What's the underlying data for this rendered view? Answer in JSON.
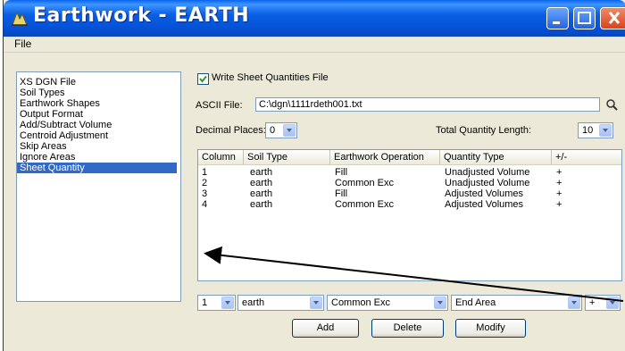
{
  "window": {
    "title": "Earthwork - EARTH"
  },
  "menu": {
    "file_label": "File"
  },
  "nav": {
    "items": [
      {
        "label": "XS DGN File"
      },
      {
        "label": "Soil Types"
      },
      {
        "label": "Earthwork Shapes"
      },
      {
        "label": "Output Format"
      },
      {
        "label": "Add/Subtract Volume"
      },
      {
        "label": "Centroid Adjustment"
      },
      {
        "label": "Skip Areas"
      },
      {
        "label": "Ignore Areas"
      },
      {
        "label": "Sheet Quantity",
        "selected": true
      }
    ]
  },
  "sheet": {
    "write_label": "Write Sheet Quantities File",
    "write_checked": true,
    "ascii_label": "ASCII File:",
    "ascii_value": "C:\\dgn\\1111rdeth001.txt",
    "decimal_label": "Decimal Places:",
    "decimal_value": "0",
    "total_label": "Total Quantity Length:",
    "total_value": "10"
  },
  "table": {
    "columns": [
      "Column",
      "Soil Type",
      "Earthwork Operation",
      "Quantity Type",
      "+/-"
    ],
    "rows": [
      [
        "1",
        "earth",
        "Fill",
        "Unadjusted Volume",
        "+"
      ],
      [
        "2",
        "earth",
        "Common Exc",
        "Unadjusted Volume",
        "+"
      ],
      [
        "3",
        "earth",
        "Fill",
        "Adjusted Volumes",
        "+"
      ],
      [
        "4",
        "earth",
        "Common Exc",
        "Adjusted Volumes",
        "+"
      ]
    ]
  },
  "editor": {
    "column": "1",
    "soil": "earth",
    "operation": "Common Exc",
    "quantity": "End Area",
    "sign": "+"
  },
  "buttons": {
    "add": "Add",
    "delete": "Delete",
    "modify": "Modify"
  },
  "colors": {
    "title_bar": "#0a5fe3",
    "selection": "#316ac5",
    "close": "#d8431c"
  }
}
